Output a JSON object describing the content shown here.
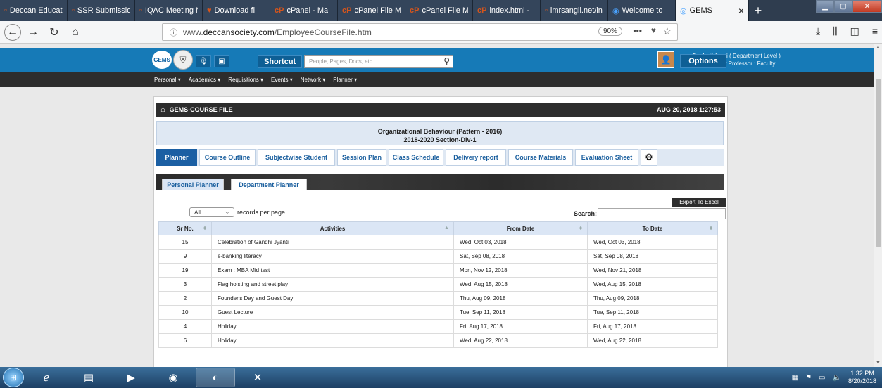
{
  "browser": {
    "tabs": [
      {
        "label": "Deccan Educatio",
        "icon": "page-icon"
      },
      {
        "label": "SSR Submission",
        "icon": "page-icon"
      },
      {
        "label": "IQAC Meeting N",
        "icon": "page-icon"
      },
      {
        "label": "Download fi",
        "icon": "heart-icon"
      },
      {
        "label": "cPanel - Ma",
        "icon": "cpanel-icon"
      },
      {
        "label": "cPanel File M",
        "icon": "cpanel-icon"
      },
      {
        "label": "cPanel File M",
        "icon": "cpanel-icon"
      },
      {
        "label": "index.html -",
        "icon": "cpanel-icon"
      },
      {
        "label": "imrsangli.net/in",
        "icon": "page-icon"
      },
      {
        "label": "Welcome to",
        "icon": "globe-icon"
      },
      {
        "label": "GEMS",
        "icon": "gems-icon"
      }
    ],
    "active_tab": 10,
    "url_prefix": "www.",
    "url_domain": "deccansociety.com",
    "url_path": "/EmployeeCourseFile.htm",
    "zoom": "90%"
  },
  "site": {
    "logo_text": "GEMS",
    "shortcut_label": "Shortcut",
    "search_placeholder": "People, Pages, Docs, etc....",
    "user_name": "Dr. Jyoti Joshi ( Department Level )",
    "user_role": "Assistant Professor : Faculty",
    "options_label": "Options",
    "menu": [
      "Personal ▾",
      "Academics ▾",
      "Requisitions ▾",
      "Events ▾",
      "Network ▾",
      "Planner ▾"
    ]
  },
  "panel": {
    "title": "GEMS-COURSE FILE",
    "timestamp": "AUG 20, 2018 1:27:53",
    "course_title": "Organizational Behaviour (Pattern - 2016)",
    "course_subtitle": "2018-2020 Section-Div-1",
    "tabs": [
      "Planner",
      "Course Outline",
      "Subjectwise Student",
      "Session Plan",
      "Class Schedule",
      "Delivery report",
      "Course Materials",
      "Evaluation Sheet"
    ],
    "active_tab": 0,
    "planner_tabs": [
      "Personal Planner",
      "Department Planner"
    ],
    "length_value": "All",
    "length_suffix": "records per page",
    "search_label": "Search:",
    "export_label": "Export To Excel",
    "columns": [
      "Sr No.",
      "Activities",
      "From Date",
      "To Date"
    ],
    "rows": [
      {
        "sr": "15",
        "activity": "Celebration of Gandhi Jyanti",
        "from": "Wed, Oct 03, 2018",
        "to": "Wed, Oct 03, 2018"
      },
      {
        "sr": "9",
        "activity": "e-banking literacy",
        "from": "Sat, Sep 08, 2018",
        "to": "Sat, Sep 08, 2018"
      },
      {
        "sr": "19",
        "activity": "Exam : MBA Mid test",
        "from": "Mon, Nov 12, 2018",
        "to": "Wed, Nov 21, 2018"
      },
      {
        "sr": "3",
        "activity": "Flag hoisting and street play",
        "from": "Wed, Aug 15, 2018",
        "to": "Wed, Aug 15, 2018"
      },
      {
        "sr": "2",
        "activity": "Founder's Day and Guest Day",
        "from": "Thu, Aug 09, 2018",
        "to": "Thu, Aug 09, 2018"
      },
      {
        "sr": "10",
        "activity": "Guest Lecture",
        "from": "Tue, Sep 11, 2018",
        "to": "Tue, Sep 11, 2018"
      },
      {
        "sr": "4",
        "activity": "Holiday",
        "from": "Fri, Aug 17, 2018",
        "to": "Fri, Aug 17, 2018"
      },
      {
        "sr": "6",
        "activity": "Holiday",
        "from": "Wed, Aug 22, 2018",
        "to": "Wed, Aug 22, 2018"
      }
    ]
  },
  "taskbar": {
    "time": "1:32 PM",
    "date": "8/20/2018"
  },
  "colors": {
    "site_blue": "#167ab7",
    "active_tab": "#1b5fa3",
    "header_dark": "#2d2d2d"
  }
}
